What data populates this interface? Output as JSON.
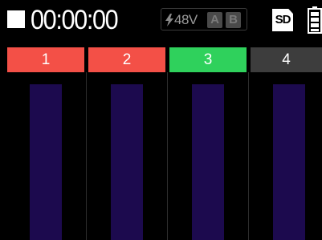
{
  "status_bar": {
    "transport_state": "stop-icon",
    "timecode": "00:00:00",
    "phantom_power": {
      "icon": "lightning-bolt-icon",
      "voltage": "48V",
      "channels": [
        "A",
        "B"
      ]
    },
    "storage_label": "SD",
    "battery_icon": "battery-icon"
  },
  "tracks": [
    {
      "number": "1",
      "state": "armed",
      "color": "#f35047"
    },
    {
      "number": "2",
      "state": "armed",
      "color": "#f35047"
    },
    {
      "number": "3",
      "state": "selected",
      "color": "#2fd15c"
    },
    {
      "number": "4",
      "state": "off",
      "color": "#3d3d3d"
    }
  ],
  "colors": {
    "background": "#000000",
    "meter_empty": "#1c0a4e",
    "text": "#ffffff"
  }
}
